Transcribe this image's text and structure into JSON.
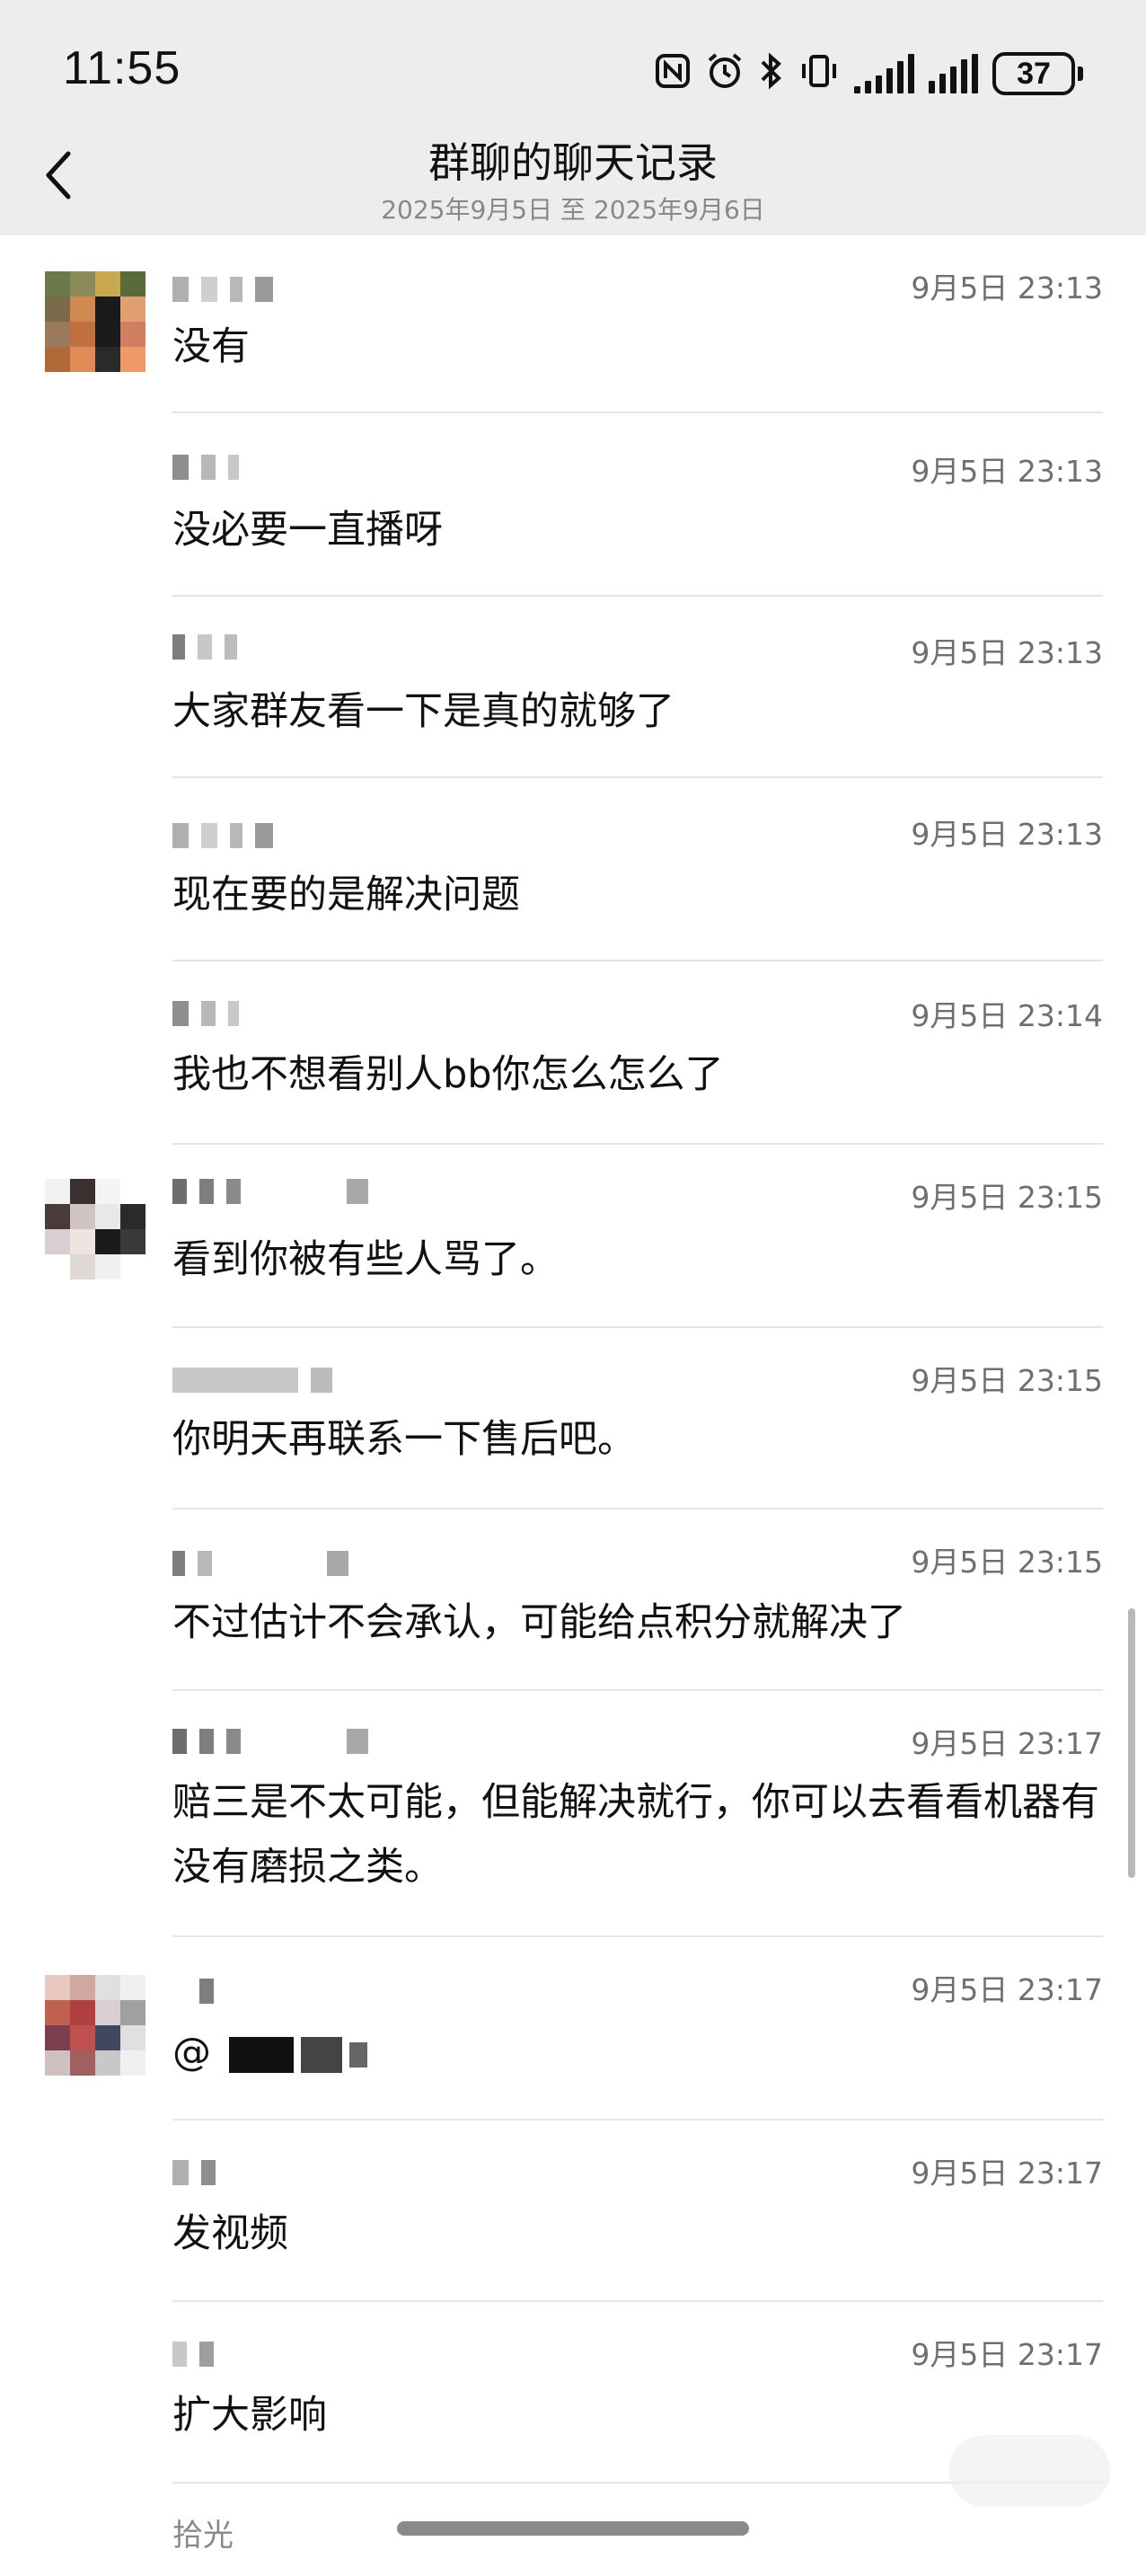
{
  "status_bar": {
    "time": "11:55",
    "battery": "37",
    "icons": [
      "nfc-icon",
      "alarm-icon",
      "bluetooth-icon",
      "vibrate-icon",
      "signal-icon",
      "signal-icon"
    ]
  },
  "header": {
    "title": "群聊的聊天记录",
    "date_range": "2025年9月5日 至 2025年9月6日",
    "back_icon": "chevron-left-icon"
  },
  "messages": [
    {
      "time": "9月5日 23:13",
      "text": "没有"
    },
    {
      "time": "9月5日 23:13",
      "text": "没必要一直播呀"
    },
    {
      "time": "9月5日 23:13",
      "text": "大家群友看一下是真的就够了"
    },
    {
      "time": "9月5日 23:13",
      "text": "现在要的是解决问题"
    },
    {
      "time": "9月5日 23:14",
      "text": "我也不想看别人bb你怎么怎么了"
    },
    {
      "time": "9月5日 23:15",
      "text": "看到你被有些人骂了。"
    },
    {
      "time": "9月5日 23:15",
      "text": "你明天再联系一下售后吧。"
    },
    {
      "time": "9月5日 23:15",
      "text": "不过估计不会承认，可能给点积分就解决了"
    },
    {
      "time": "9月5日 23:17",
      "text": "赔三是不太可能，但能解决就行，你可以去看看机器有没有磨损之类。"
    },
    {
      "time": "9月5日 23:17",
      "text": "@"
    },
    {
      "time": "9月5日 23:17",
      "text": "发视频"
    },
    {
      "time": "9月5日 23:17",
      "text": "扩大影响"
    }
  ],
  "last_sender": "拾光",
  "colors": {
    "header_bg": "#ededed",
    "time_gray": "#6f6f6f",
    "divider": "#e6e6e6"
  }
}
